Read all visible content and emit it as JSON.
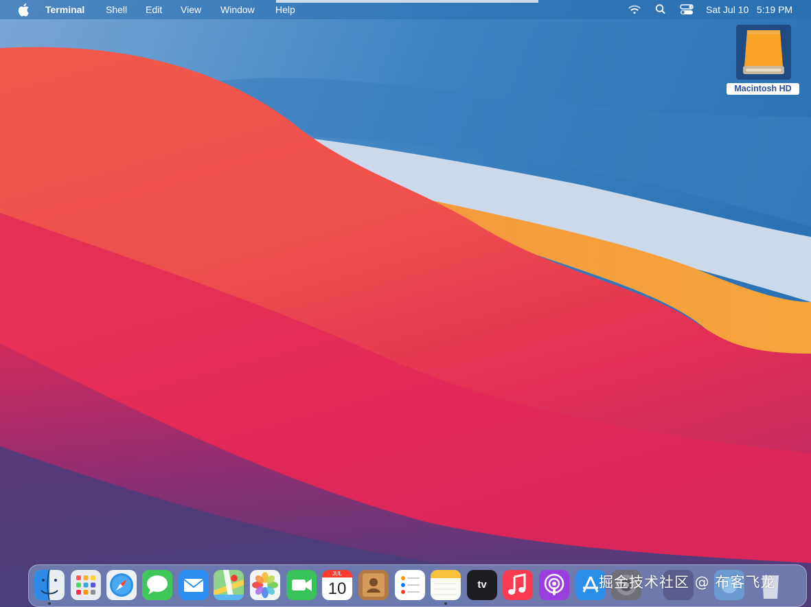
{
  "menubar": {
    "app_name": "Terminal",
    "items": [
      "Shell",
      "Edit",
      "View",
      "Window",
      "Help"
    ],
    "clock": "Sat Jul 10   5:19 PM",
    "icons": [
      "apple-icon",
      "wifi-icon",
      "spotlight-icon",
      "control-center-icon"
    ]
  },
  "desktop": {
    "drive_label": "Macintosh HD"
  },
  "dock": {
    "apps": [
      "finder",
      "launchpad",
      "safari",
      "messages",
      "mail",
      "maps",
      "photos",
      "facetime",
      "calendar",
      "contacts",
      "reminders",
      "notes",
      "tv",
      "music",
      "podcasts",
      "app-store",
      "system-preferences",
      "folder",
      "downloads",
      "trash"
    ],
    "calendar_month": "JUL",
    "calendar_day": "10",
    "tv_label": "tv"
  },
  "watermark": "掘金技术社区 @ 布客飞龙",
  "colors": {
    "sky": "#2f78b6",
    "wave_red": "#e8514a",
    "wave_orange": "#f6a23d",
    "wave_light": "#cbd9ea",
    "purple": "#6a3a7c"
  }
}
